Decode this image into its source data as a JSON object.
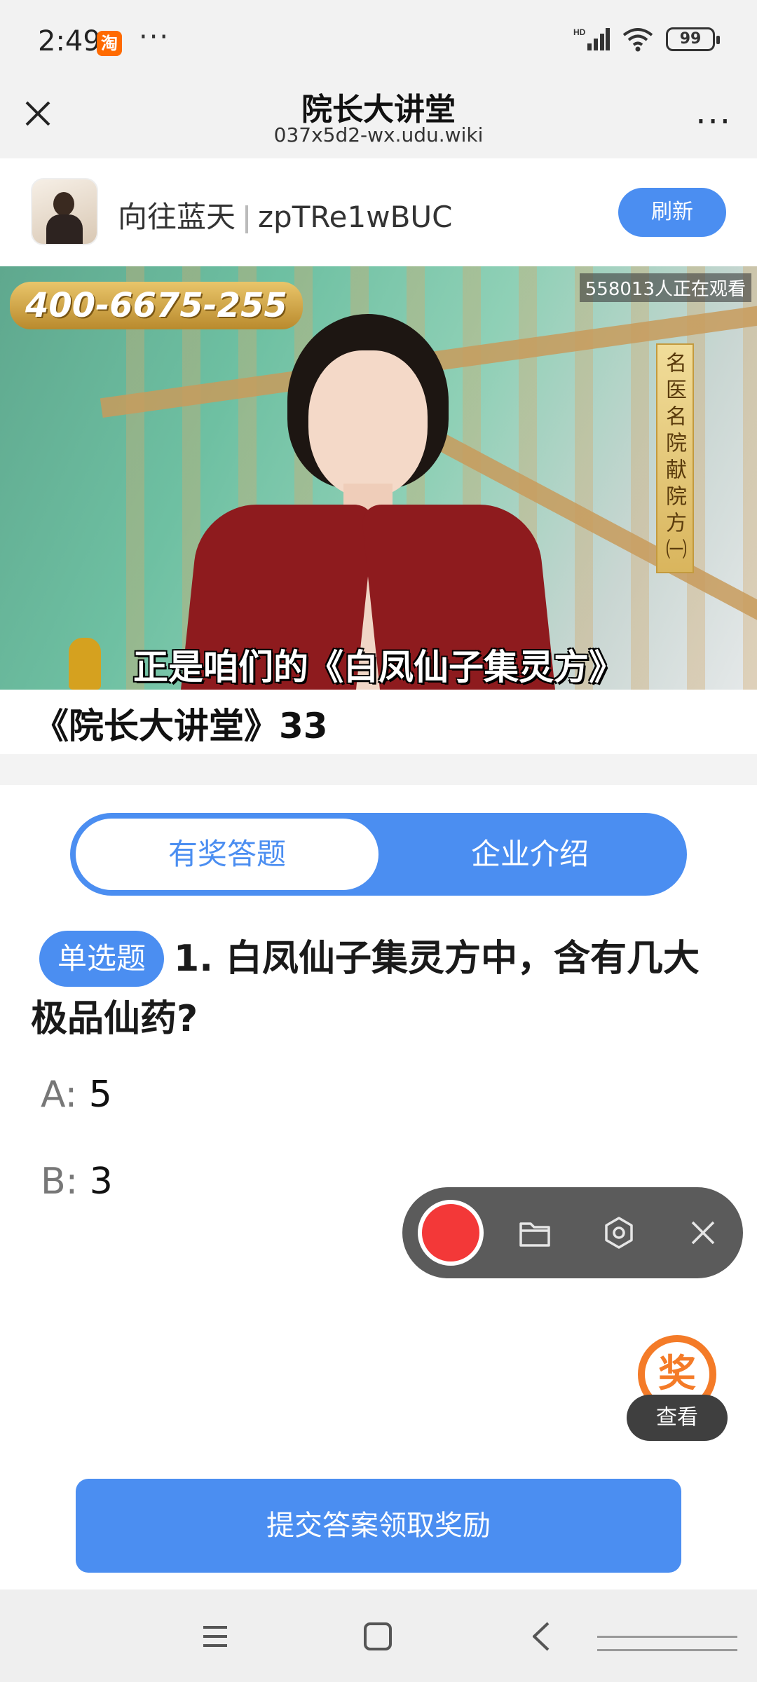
{
  "status_bar": {
    "time": "2:49",
    "app_badge": "淘",
    "more_dots": "···",
    "battery": "99"
  },
  "title_bar": {
    "title": "院长大讲堂",
    "url": "037x5d2-wx.udu.wiki",
    "more": "···"
  },
  "channel": {
    "name": "向往蓝天",
    "id": "zpTRe1wBUC",
    "refresh_label": "刷新"
  },
  "video": {
    "phone_banner": "400-6675-255",
    "viewers": "558013人正在观看",
    "vertical_banner": "名医名院献院方㈠",
    "subtitle": "正是咱们的《白凤仙子集灵方》",
    "title": "《院长大讲堂》33"
  },
  "tabs": [
    {
      "label": "有奖答题",
      "active": true
    },
    {
      "label": "企业介绍",
      "active": false
    }
  ],
  "question": {
    "type_badge": "单选题",
    "text": "1. 白凤仙子集灵方中，含有几大极品仙药?",
    "options": [
      {
        "key": "A:",
        "value": "5"
      },
      {
        "key": "B:",
        "value": "3"
      }
    ]
  },
  "recorder": {
    "icons": [
      "record-icon",
      "folder-icon",
      "settings-icon",
      "close-icon"
    ]
  },
  "award": {
    "badge": "奖",
    "view_label": "查看"
  },
  "submit_label": "提交答案领取奖励",
  "colors": {
    "accent": "#4b8ef1",
    "record": "#f33838",
    "award": "#f47b28"
  }
}
